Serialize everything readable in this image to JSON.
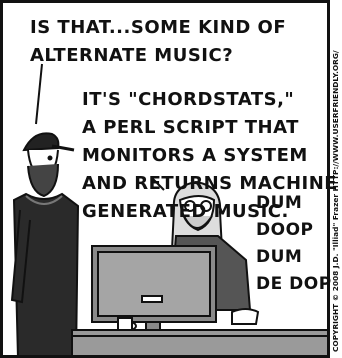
{
  "comic": {
    "dialogue_top": "IS THAT...SOME KIND OF\nALTERNATE MUSIC?",
    "dialogue_reply": "IT'S \"CHORDSTATS,\"\nA PERL SCRIPT THAT\nMONITORS A SYSTEM\nAND RETURNS MACHINE\nGENERATED MUSIC.",
    "sound_effect": "DUM\nDOOP\nDUM\nDE DOP",
    "credit": "COPYRIGHT © 2008 J.D. \"Illiad\" Frazer  HTTP://WWW.USERFRIENDLY.ORG/"
  },
  "colors": {
    "ink": "#111111",
    "screen_grey": "#8a8a8a",
    "desk_grey": "#9a9a9a",
    "shirt_dark": "#2a2a2a"
  }
}
